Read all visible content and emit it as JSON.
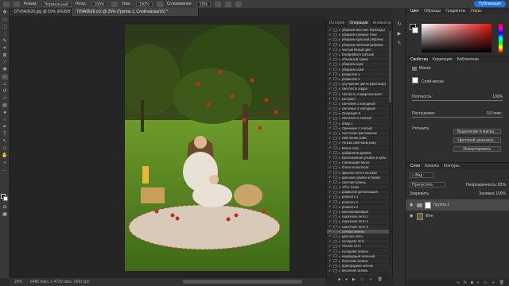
{
  "optionsbar": {
    "mode_label": "Режим:",
    "mode_value": "Нормальный",
    "opacity_label": "Непр.:",
    "opacity_value": "100%",
    "pressure_label": "Наж.:",
    "pressure_value": "100%",
    "smooth_label": "Сглаживание:",
    "smooth_value": "10%",
    "publish_label": "Публикация"
  },
  "tabs": [
    {
      "label": "07V9A9626.jpg @ 50% (RGB/8*)"
    },
    {
      "label": "7V9A9626.cr2 @ 25% (Группа 1, Слой-маска/16) *"
    }
  ],
  "status": {
    "zoom": "25%",
    "doc": "6480 пикс. x 4720 пикс. (300 ppi)"
  },
  "history_panel": {
    "tabs": [
      "История",
      "Операции",
      "Аниматор"
    ],
    "active_tab": "Операции",
    "actions": [
      "убираем жесткие переходы",
      "убираем грязные тени",
      "убираем красный рефлекс",
      "убираем зеленый рефлекс",
      "чистый белый цвет",
      "Dodge&Burn (объем)",
      "объемный туман",
      "убираем шум",
      "убираем кожи",
      "размытие 1",
      "размытие 2",
      "улучшение цвета (цветокор)",
      "светлость кадра",
      "Четкость и микроконтраст",
      "контраст",
      "свечение 3 холодный",
      "свечение 4 холодный",
      "Операция 3",
      "свечение 5 теплый",
      "блюр 1",
      "Свечение 4 теплый",
      "частотное разложение",
      "смягчение кожи",
      "только смягчаем кожу",
      "Блеск глаз",
      "добавляем румяна",
      "Белоснежная улыбка и зубы",
      "стилизация волос",
      "блеск на волосах",
      "красное пятно на коже",
      "красные румяна и брови",
      "светлая зелень",
      "ч/б в тонах",
      "размытая детализация",
      "резкость 1",
      "резкость 2",
      "резкость 3",
      "монохромизация",
      "сказочное лето 1",
      "сказочное лето 2",
      "сказочное лето 3",
      "сочная зелень",
      "цветное лето",
      "холодное лето",
      "теплое лето",
      "холодная зелень",
      "изумрудный зеленый",
      "болотная зелень",
      "пригородная зелень",
      "весенняя зелень"
    ],
    "selected_action": "сочная зелень"
  },
  "color_panel": {
    "tabs": [
      "Цвет",
      "Образцы",
      "Градиенты",
      "Узоры"
    ],
    "fg_color": "#000000",
    "accent": "#e21414"
  },
  "properties_panel": {
    "tabs": [
      "Свойства",
      "Коррекция",
      "Библиотеки"
    ],
    "section": "Маски",
    "mask_label": "Слой-маска",
    "density_label": "Плотность:",
    "density_value": "100%",
    "feather_label": "Растушевка:",
    "feather_value": "0,0 пикс.",
    "refine_label": "Уточнить:",
    "btn_select_mask": "Выделение и маска...",
    "btn_color_range": "Цветовой диапазон...",
    "btn_invert": "Инвертировать"
  },
  "layers_panel": {
    "tabs": [
      "Слои",
      "Каналы",
      "Контуры"
    ],
    "kind_label": "Вид",
    "blend_mode": "Пропустить",
    "opacity_label": "Непрозрачность:",
    "opacity_value": "82%",
    "lock_label": "Закрепить:",
    "fill_label": "Заливка:",
    "fill_value": "100%",
    "layers": [
      {
        "name": "Группа 1",
        "kind": "group",
        "selected": true
      },
      {
        "name": "Фон",
        "kind": "image",
        "selected": false
      }
    ]
  }
}
